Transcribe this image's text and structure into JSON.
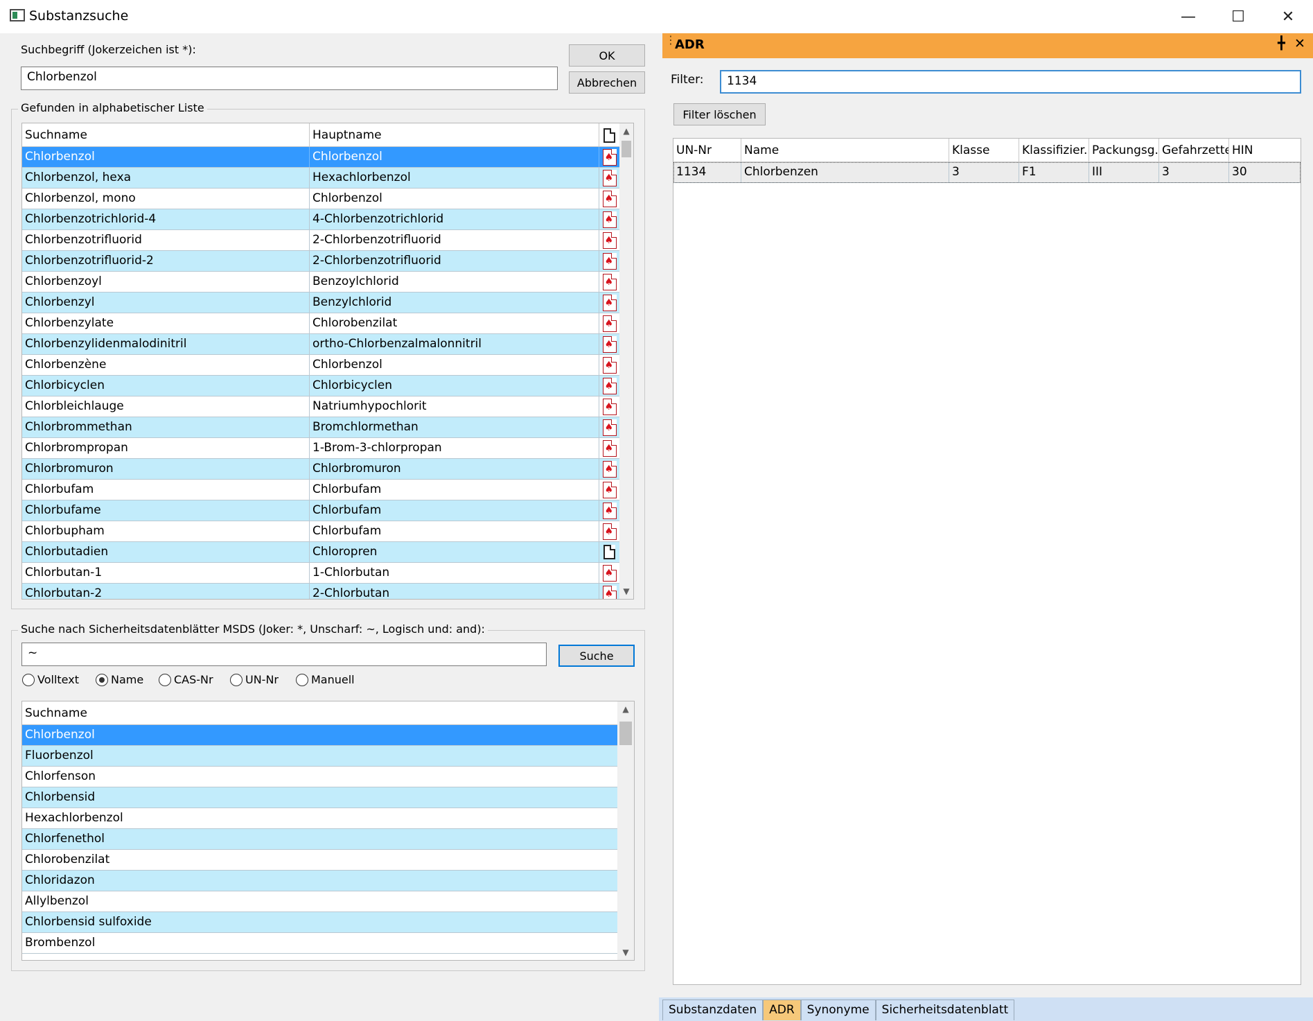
{
  "window": {
    "title": "Substanzsuche"
  },
  "search": {
    "label": "Suchbegriff (Jokerzeichen ist *):",
    "value": "Chlorbenzol",
    "ok_label": "OK",
    "cancel_label": "Abbrechen"
  },
  "found": {
    "group_title": "Gefunden in alphabetischer Liste",
    "columns": [
      "Suchname",
      "Hauptname"
    ],
    "rows": [
      {
        "suchname": "Chlorbenzol",
        "hauptname": "Chlorbenzol",
        "icon": "pdf-icon",
        "selected": true
      },
      {
        "suchname": "Chlorbenzol, hexa",
        "hauptname": "Hexachlorbenzol",
        "icon": "pdf-icon"
      },
      {
        "suchname": "Chlorbenzol, mono",
        "hauptname": "Chlorbenzol",
        "icon": "pdf-icon"
      },
      {
        "suchname": "Chlorbenzotrichlorid-4",
        "hauptname": "4-Chlorbenzotrichlorid",
        "icon": "pdf-icon"
      },
      {
        "suchname": "Chlorbenzotrifluorid",
        "hauptname": "2-Chlorbenzotrifluorid",
        "icon": "pdf-icon"
      },
      {
        "suchname": "Chlorbenzotrifluorid-2",
        "hauptname": "2-Chlorbenzotrifluorid",
        "icon": "pdf-icon"
      },
      {
        "suchname": "Chlorbenzoyl",
        "hauptname": "Benzoylchlorid",
        "icon": "pdf-icon"
      },
      {
        "suchname": "Chlorbenzyl",
        "hauptname": "Benzylchlorid",
        "icon": "pdf-icon"
      },
      {
        "suchname": "Chlorbenzylate",
        "hauptname": "Chlorobenzilat",
        "icon": "pdf-icon"
      },
      {
        "suchname": "Chlorbenzylidenmalodinitril",
        "hauptname": "ortho-Chlorbenzalmalonnitril",
        "icon": "pdf-icon"
      },
      {
        "suchname": "Chlorbenzène",
        "hauptname": "Chlorbenzol",
        "icon": "pdf-icon"
      },
      {
        "suchname": "Chlorbicyclen",
        "hauptname": "Chlorbicyclen",
        "icon": "pdf-icon"
      },
      {
        "suchname": "Chlorbleichlauge",
        "hauptname": "Natriumhypochlorit",
        "icon": "pdf-icon"
      },
      {
        "suchname": "Chlorbrommethan",
        "hauptname": "Bromchlormethan",
        "icon": "pdf-icon"
      },
      {
        "suchname": "Chlorbrompropan",
        "hauptname": "1-Brom-3-chlorpropan",
        "icon": "pdf-icon"
      },
      {
        "suchname": "Chlorbromuron",
        "hauptname": "Chlorbromuron",
        "icon": "pdf-icon"
      },
      {
        "suchname": "Chlorbufam",
        "hauptname": "Chlorbufam",
        "icon": "pdf-icon"
      },
      {
        "suchname": "Chlorbufame",
        "hauptname": "Chlorbufam",
        "icon": "pdf-icon"
      },
      {
        "suchname": "Chlorbupham",
        "hauptname": "Chlorbufam",
        "icon": "pdf-icon"
      },
      {
        "suchname": "Chlorbutadien",
        "hauptname": "Chloropren",
        "icon": "doc-icon"
      },
      {
        "suchname": "Chlorbutan-1",
        "hauptname": "1-Chlorbutan",
        "icon": "pdf-icon"
      },
      {
        "suchname": "Chlorbutan-2",
        "hauptname": "2-Chlorbutan",
        "icon": "pdf-icon"
      }
    ]
  },
  "msds": {
    "group_title": "Suche nach Sicherheitsdatenblätter MSDS (Joker: *, Unscharf: ~, Logisch und: and):",
    "value": "~",
    "search_label": "Suche",
    "radios": [
      {
        "label": "Volltext",
        "checked": false
      },
      {
        "label": "Name",
        "checked": true
      },
      {
        "label": "CAS-Nr",
        "checked": false
      },
      {
        "label": "UN-Nr",
        "checked": false
      },
      {
        "label": "Manuell",
        "checked": false
      }
    ],
    "column": "Suchname",
    "rows": [
      {
        "suchname": "Chlorbenzol",
        "selected": true
      },
      {
        "suchname": "Fluorbenzol"
      },
      {
        "suchname": "Chlorfenson"
      },
      {
        "suchname": "Chlorbensid"
      },
      {
        "suchname": "Hexachlorbenzol"
      },
      {
        "suchname": "Chlorfenethol"
      },
      {
        "suchname": "Chlorobenzilat"
      },
      {
        "suchname": "Chloridazon"
      },
      {
        "suchname": "Allylbenzol"
      },
      {
        "suchname": "Chlorbensid sulfoxide"
      },
      {
        "suchname": "Brombenzol"
      }
    ]
  },
  "adr": {
    "title": "ADR",
    "filter_label": "Filter:",
    "filter_value": "1134",
    "clear_label": "Filter löschen",
    "columns": [
      "UN-Nr",
      "Name",
      "Klasse",
      "Klassifizier...",
      "Packungsg.",
      "Gefahrzettel",
      "HIN"
    ],
    "rows": [
      [
        "1134",
        "Chlorbenzen",
        "3",
        "F1",
        "III",
        "3",
        "30"
      ]
    ]
  },
  "tabs": [
    {
      "label": "Substanzdaten",
      "active": false
    },
    {
      "label": "ADR",
      "active": true
    },
    {
      "label": "Synonyme",
      "active": false
    },
    {
      "label": "Sicherheitsdatenblatt",
      "active": false
    }
  ],
  "colors": {
    "selection": "#3399ff",
    "alt_row": "#c2ecfb",
    "panel_header": "#f6a440",
    "active_tab": "#f6c87a"
  }
}
